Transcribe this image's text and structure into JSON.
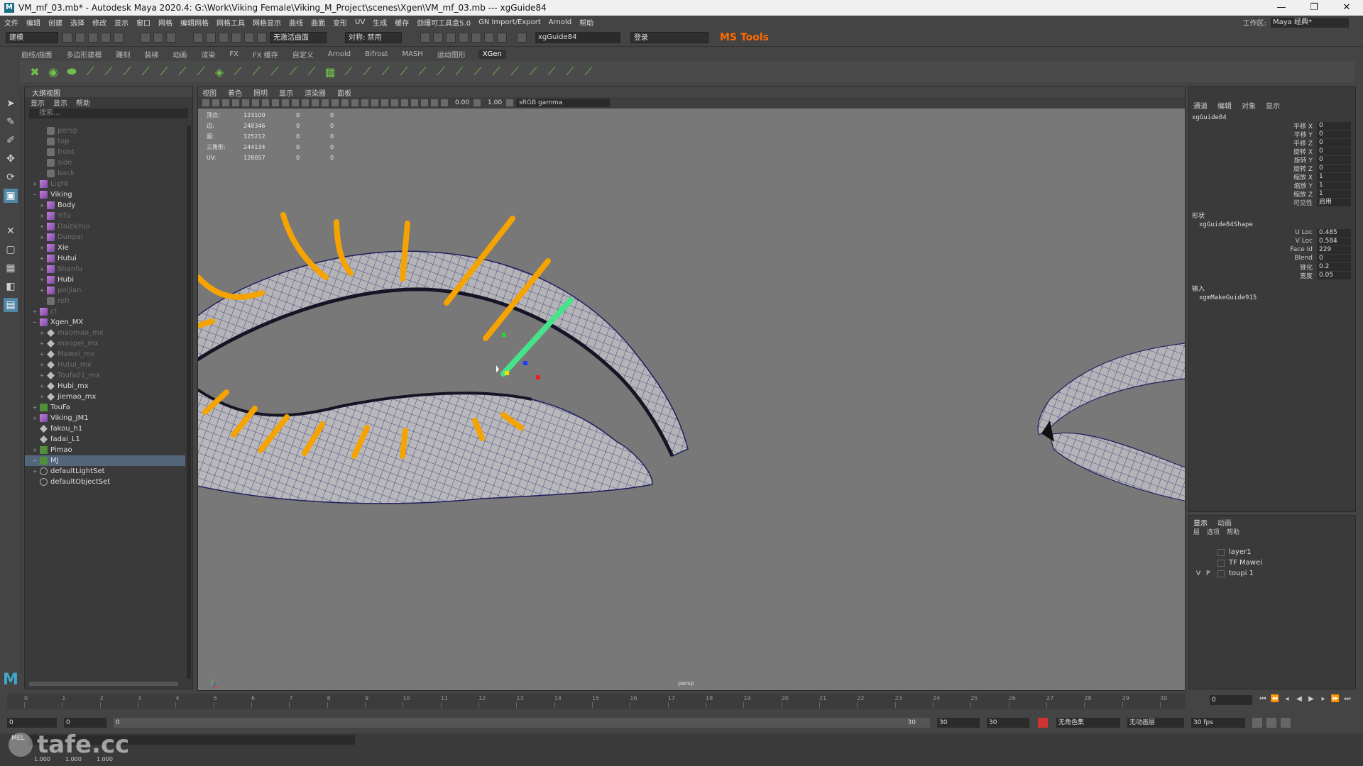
{
  "window": {
    "title": "VM_mf_03.mb* - Autodesk Maya 2020.4: G:\\Work\\Viking Female\\Viking_M_Project\\scenes\\Xgen\\VM_mf_03.mb   ---   xgGuide84",
    "minimize": "—",
    "maximize": "❐",
    "close": "✕"
  },
  "menubar": {
    "items": [
      "文件",
      "编辑",
      "创建",
      "选择",
      "修改",
      "显示",
      "窗口",
      "网格",
      "编辑网格",
      "网格工具",
      "网格显示",
      "曲线",
      "曲面",
      "变形",
      "UV",
      "生成",
      "缓存",
      "劲爆可工具盒5.0",
      "GN Import/Export",
      "Arnold",
      "帮助"
    ],
    "workspace_label": "工作区:",
    "workspace_value": "Maya 经典*"
  },
  "statusline": {
    "mode": "建模",
    "select_mode": "无激活曲面",
    "symmetry": "对称: 禁用",
    "input_field": "xgGuide84",
    "login": "登录",
    "mstools": "MS Tools"
  },
  "shelf_tabs": [
    "曲线/曲面",
    "多边形建模",
    "雕刻",
    "装绑",
    "动画",
    "渲染",
    "FX",
    "FX 缓存",
    "自定义",
    "Arnold",
    "Bifrost",
    "MASH",
    "运动图形",
    "XGen"
  ],
  "shelf_active": "XGen",
  "outliner": {
    "title": "大纲视图",
    "menu": [
      "显示",
      "显示",
      "帮助"
    ],
    "search_placeholder": "搜索...",
    "items": [
      {
        "label": "persp",
        "icon": "cam",
        "indent": 1,
        "dim": true,
        "exp": ""
      },
      {
        "label": "top",
        "icon": "cam",
        "indent": 1,
        "dim": true,
        "exp": ""
      },
      {
        "label": "front",
        "icon": "cam",
        "indent": 1,
        "dim": true,
        "exp": ""
      },
      {
        "label": "side",
        "icon": "cam",
        "indent": 1,
        "dim": true,
        "exp": ""
      },
      {
        "label": "back",
        "icon": "cam",
        "indent": 1,
        "dim": true,
        "exp": ""
      },
      {
        "label": "Light",
        "icon": "grp",
        "indent": 0,
        "dim": true,
        "exp": "+"
      },
      {
        "label": "Viking",
        "icon": "grp",
        "indent": 0,
        "dim": false,
        "exp": "−"
      },
      {
        "label": "Body",
        "icon": "grp",
        "indent": 1,
        "dim": false,
        "exp": "+"
      },
      {
        "label": "Yifu",
        "icon": "grp",
        "indent": 1,
        "dim": true,
        "exp": "+"
      },
      {
        "label": "Daizichui",
        "icon": "grp",
        "indent": 1,
        "dim": true,
        "exp": "+"
      },
      {
        "label": "Dunpai",
        "icon": "grp",
        "indent": 1,
        "dim": true,
        "exp": "+"
      },
      {
        "label": "Xie",
        "icon": "grp",
        "indent": 1,
        "dim": false,
        "exp": "+"
      },
      {
        "label": "Hutui",
        "icon": "grp",
        "indent": 1,
        "dim": false,
        "exp": "+"
      },
      {
        "label": "Shanfu",
        "icon": "grp",
        "indent": 1,
        "dim": true,
        "exp": "+"
      },
      {
        "label": "Hubi",
        "icon": "grp",
        "indent": 1,
        "dim": false,
        "exp": "+"
      },
      {
        "label": "peijian",
        "icon": "grp",
        "indent": 1,
        "dim": true,
        "exp": "+"
      },
      {
        "label": "refr",
        "icon": "cam",
        "indent": 1,
        "dim": true,
        "exp": ""
      },
      {
        "label": "ct",
        "icon": "grp",
        "indent": 0,
        "dim": true,
        "exp": "+"
      },
      {
        "label": "Xgen_MX",
        "icon": "grp",
        "indent": 0,
        "dim": false,
        "exp": "−"
      },
      {
        "label": "maomao_mx",
        "icon": "diamond",
        "indent": 1,
        "dim": true,
        "exp": "+"
      },
      {
        "label": "maopei_mx",
        "icon": "diamond",
        "indent": 1,
        "dim": true,
        "exp": "+"
      },
      {
        "label": "Mawei_mx",
        "icon": "diamond",
        "indent": 1,
        "dim": true,
        "exp": "+"
      },
      {
        "label": "Hutui_mx",
        "icon": "diamond",
        "indent": 1,
        "dim": true,
        "exp": "+"
      },
      {
        "label": "Toufa01_mx",
        "icon": "diamond",
        "indent": 1,
        "dim": true,
        "exp": "+"
      },
      {
        "label": "Hubi_mx",
        "icon": "diamond",
        "indent": 1,
        "dim": false,
        "exp": "+"
      },
      {
        "label": "jiemao_mx",
        "icon": "diamond",
        "indent": 1,
        "dim": false,
        "exp": "+"
      },
      {
        "label": "TouFa",
        "icon": "xg",
        "indent": 0,
        "dim": false,
        "exp": "+"
      },
      {
        "label": "Viking_JM1",
        "icon": "grp",
        "indent": 0,
        "dim": false,
        "exp": "+"
      },
      {
        "label": "fakou_h1",
        "icon": "diamond",
        "indent": 0,
        "dim": false,
        "exp": ""
      },
      {
        "label": "fadai_L1",
        "icon": "diamond",
        "indent": 0,
        "dim": false,
        "exp": ""
      },
      {
        "label": "Pimao",
        "icon": "xg",
        "indent": 0,
        "dim": false,
        "exp": "+"
      },
      {
        "label": "MJ",
        "icon": "xg",
        "indent": 0,
        "dim": false,
        "exp": "+",
        "selected": true
      },
      {
        "label": "defaultLightSet",
        "icon": "set",
        "indent": 0,
        "dim": false,
        "exp": "+"
      },
      {
        "label": "defaultObjectSet",
        "icon": "set",
        "indent": 0,
        "dim": false,
        "exp": ""
      }
    ]
  },
  "viewport": {
    "menu": [
      "视图",
      "着色",
      "照明",
      "显示",
      "渲染器",
      "面板"
    ],
    "exposure": "0.00",
    "gamma": "1.00",
    "colorspace": "sRGB gamma",
    "camera_label": "persp",
    "hud": [
      {
        "label": "顶点:",
        "v": "123100",
        "a": "0",
        "b": "0"
      },
      {
        "label": "边:",
        "v": "248346",
        "a": "0",
        "b": "0"
      },
      {
        "label": "面:",
        "v": "125212",
        "a": "0",
        "b": "0"
      },
      {
        "label": "三角形:",
        "v": "244134",
        "a": "0",
        "b": "0"
      },
      {
        "label": "UV:",
        "v": "128057",
        "a": "0",
        "b": "0"
      }
    ],
    "colors": {
      "background": "#787878",
      "lash": "#f5a300",
      "guide": "#47e38a",
      "mesh": "#b5b5b8",
      "wire": "#26266e"
    }
  },
  "attribute_editor": {
    "menu": [
      "通道",
      "编辑",
      "对象",
      "显示"
    ],
    "node": "xgGuide84",
    "transform": [
      {
        "label": "平移 X",
        "value": "0"
      },
      {
        "label": "平移 Y",
        "value": "0"
      },
      {
        "label": "平移 Z",
        "value": "0"
      },
      {
        "label": "旋转 X",
        "value": "0"
      },
      {
        "label": "旋转 Y",
        "value": "0"
      },
      {
        "label": "旋转 Z",
        "value": "0"
      },
      {
        "label": "缩放 X",
        "value": "1"
      },
      {
        "label": "缩放 Y",
        "value": "1"
      },
      {
        "label": "缩放 Z",
        "value": "1"
      },
      {
        "label": "可见性",
        "value": "启用"
      }
    ],
    "shape_header": "形状",
    "shape_node": "xgGuide84Shape",
    "shape_attrs": [
      {
        "label": "U Loc",
        "value": "0.485"
      },
      {
        "label": "V Loc",
        "value": "0.584"
      },
      {
        "label": "Face Id",
        "value": "229"
      },
      {
        "label": "Blend",
        "value": "0"
      },
      {
        "label": "锥化",
        "value": "0.2"
      },
      {
        "label": "宽度",
        "value": "0.05"
      }
    ],
    "input_header": "输入",
    "input_node": "xgmMakeGuide915"
  },
  "layers": {
    "tabs": [
      "显示",
      "动画"
    ],
    "menu": [
      "层",
      "选项",
      "帮助"
    ],
    "rows": [
      {
        "v": "",
        "p": "",
        "name": "layer1"
      },
      {
        "v": "",
        "p": "",
        "name": "TF Mawei"
      },
      {
        "v": "V",
        "p": "P",
        "name": "toupi 1"
      }
    ]
  },
  "timeline": {
    "ticks": [
      "0",
      "1",
      "2",
      "3",
      "4",
      "5",
      "6",
      "7",
      "8",
      "9",
      "10",
      "11",
      "12",
      "13",
      "14",
      "15",
      "16",
      "17",
      "18",
      "19",
      "20",
      "21",
      "22",
      "23",
      "24",
      "25",
      "26",
      "27",
      "28",
      "29",
      "30"
    ],
    "current_frame": "0",
    "range_start": "0",
    "range_inner_start": "0",
    "range_slider_start": "0",
    "range_slider_end": "30",
    "range_end": "30",
    "anim_end": "30",
    "character_set": "无角色集",
    "anim_layer": "无动画层",
    "fps": "30 fps"
  },
  "commandline": {
    "mel": "MEL"
  },
  "helpline": {
    "values": [
      "1.000",
      "1.000",
      "1.000"
    ]
  },
  "watermark": "tafe.cc"
}
